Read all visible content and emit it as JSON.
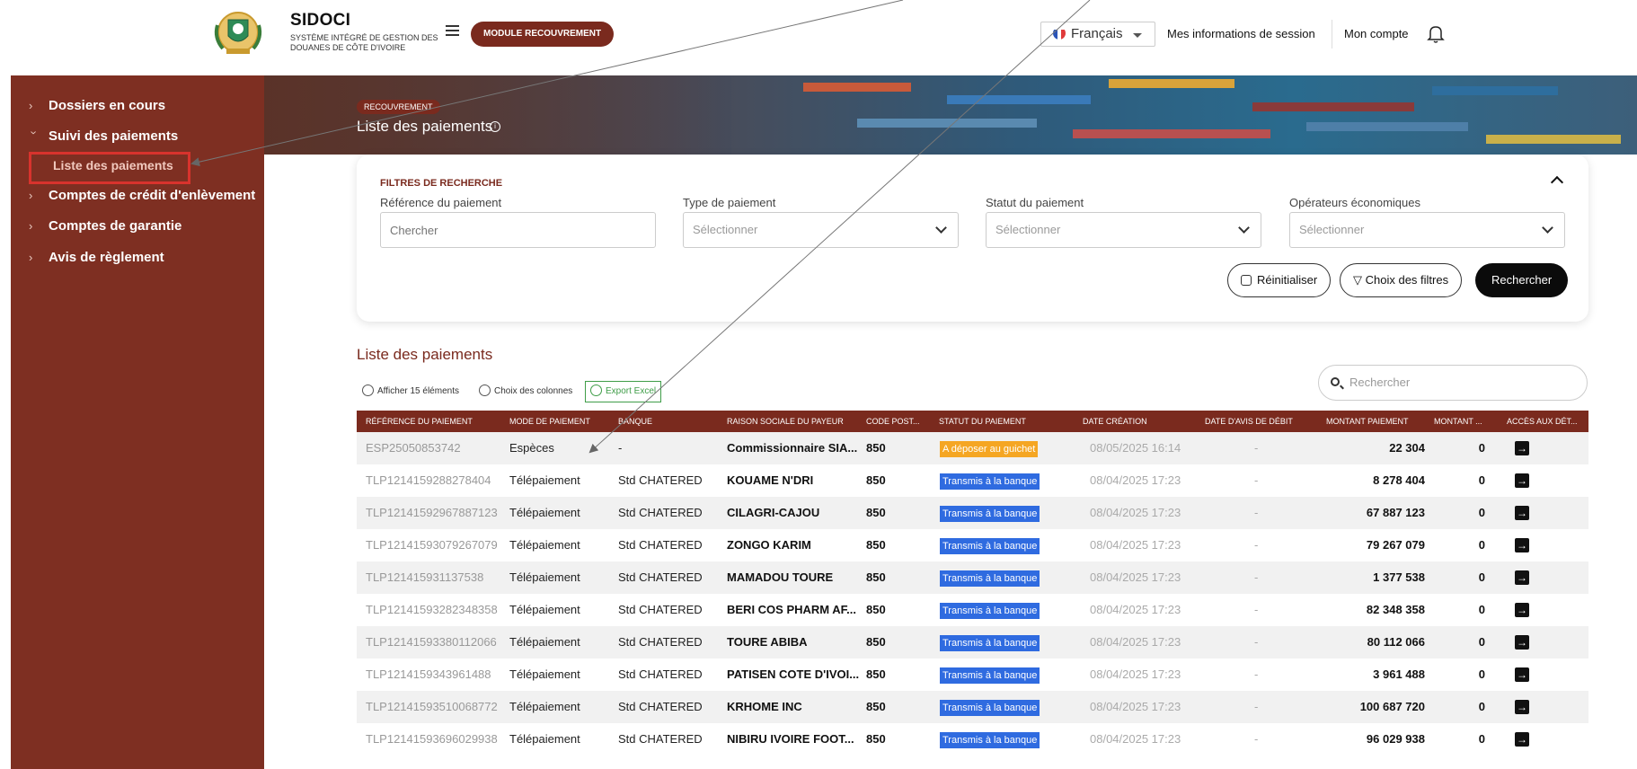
{
  "header": {
    "brand_name": "SIDOCI",
    "brand_sub": "Système intégré de gestion des douanes de Côte d'Ivoire",
    "module_button": "MODULE RECOUVREMENT",
    "language": "Français",
    "session_link": "Mes informations de session",
    "account_link": "Mon compte"
  },
  "sidebar": {
    "items": [
      {
        "label": "Dossiers en cours"
      },
      {
        "label": "Suivi des paiements"
      },
      {
        "label": "Liste des paiements"
      },
      {
        "label": "Comptes de crédit d'enlèvement"
      },
      {
        "label": "Comptes de garantie"
      },
      {
        "label": "Avis de règlement"
      }
    ]
  },
  "hero": {
    "breadcrumb": "RECOUVREMENT",
    "title": "Liste des paiements"
  },
  "filters": {
    "title": "FILTRES DE RECHERCHE",
    "ref_label": "Référence du paiement",
    "ref_placeholder": "Chercher",
    "type_label": "Type de paiement",
    "type_value": "Sélectionner",
    "status_label": "Statut du paiement",
    "status_value": "Sélectionner",
    "operators_label": "Opérateurs économiques",
    "operators_value": "Sélectionner",
    "reset_button": "Réinitialiser",
    "choose_filters_button": "Choix des filtres",
    "search_button": "Rechercher"
  },
  "list": {
    "title": "Liste des paiements",
    "show_items": "Afficher 15 éléments",
    "choose_columns": "Choix des colonnes",
    "export": "Export Excel",
    "search_placeholder": "Rechercher",
    "columns": [
      "RÉFÉRENCE DU PAIEMENT",
      "MODE DE PAIEMENT",
      "BANQUE",
      "RAISON SOCIALE DU PAYEUR",
      "CODE POST...",
      "STATUT DU PAIEMENT",
      "DATE CRÉATION",
      "DATE D'AVIS DE DÉBIT",
      "MONTANT PAIEMENT",
      "MONTANT ...",
      "ACCÈS AUX DÉT..."
    ],
    "rows": [
      {
        "ref": "ESP25050853742",
        "mode": "Espèces",
        "bank": "-",
        "payer": "Commissionnaire SIA...",
        "code": "850",
        "status": "A déposer au guichet",
        "status_color": "#f5a623",
        "created": "08/05/2025 16:14",
        "debit": "-",
        "amount": "22 304",
        "amount2": "0"
      },
      {
        "ref": "TLP1214159288278404",
        "mode": "Télépaiement",
        "bank": "Std CHATERED",
        "payer": "KOUAME N'DRI",
        "code": "850",
        "status": "Transmis à la banque",
        "status_color": "#2f6be0",
        "created": "08/04/2025 17:23",
        "debit": "-",
        "amount": "8 278 404",
        "amount2": "0"
      },
      {
        "ref": "TLP12141592967887123",
        "mode": "Télépaiement",
        "bank": "Std CHATERED",
        "payer": "CILAGRI-CAJOU",
        "code": "850",
        "status": "Transmis à la banque",
        "status_color": "#2f6be0",
        "created": "08/04/2025 17:23",
        "debit": "-",
        "amount": "67 887 123",
        "amount2": "0"
      },
      {
        "ref": "TLP12141593079267079",
        "mode": "Télépaiement",
        "bank": "Std CHATERED",
        "payer": "ZONGO KARIM",
        "code": "850",
        "status": "Transmis à la banque",
        "status_color": "#2f6be0",
        "created": "08/04/2025 17:23",
        "debit": "-",
        "amount": "79 267 079",
        "amount2": "0"
      },
      {
        "ref": "TLP121415931137538",
        "mode": "Télépaiement",
        "bank": "Std CHATERED",
        "payer": "MAMADOU TOURE",
        "code": "850",
        "status": "Transmis à la banque",
        "status_color": "#2f6be0",
        "created": "08/04/2025 17:23",
        "debit": "-",
        "amount": "1 377 538",
        "amount2": "0"
      },
      {
        "ref": "TLP12141593282348358",
        "mode": "Télépaiement",
        "bank": "Std CHATERED",
        "payer": "BERI COS PHARM AF...",
        "code": "850",
        "status": "Transmis à la banque",
        "status_color": "#2f6be0",
        "created": "08/04/2025 17:23",
        "debit": "-",
        "amount": "82 348 358",
        "amount2": "0"
      },
      {
        "ref": "TLP12141593380112066",
        "mode": "Télépaiement",
        "bank": "Std CHATERED",
        "payer": "TOURE ABIBA",
        "code": "850",
        "status": "Transmis à la banque",
        "status_color": "#2f6be0",
        "created": "08/04/2025 17:23",
        "debit": "-",
        "amount": "80 112 066",
        "amount2": "0"
      },
      {
        "ref": "TLP1214159343961488",
        "mode": "Télépaiement",
        "bank": "Std CHATERED",
        "payer": "PATISEN COTE D'IVOI...",
        "code": "850",
        "status": "Transmis à la banque",
        "status_color": "#2f6be0",
        "created": "08/04/2025 17:23",
        "debit": "-",
        "amount": "3 961 488",
        "amount2": "0"
      },
      {
        "ref": "TLP12141593510068772",
        "mode": "Télépaiement",
        "bank": "Std CHATERED",
        "payer": "KRHOME INC",
        "code": "850",
        "status": "Transmis à la banque",
        "status_color": "#2f6be0",
        "created": "08/04/2025 17:23",
        "debit": "-",
        "amount": "100 687 720",
        "amount2": "0"
      },
      {
        "ref": "TLP12141593696029938",
        "mode": "Télépaiement",
        "bank": "Std CHATERED",
        "payer": "NIBIRU IVOIRE FOOT...",
        "code": "850",
        "status": "Transmis à la banque",
        "status_color": "#2f6be0",
        "created": "08/04/2025 17:23",
        "debit": "-",
        "amount": "96 029 938",
        "amount2": "0"
      }
    ]
  },
  "colors": {
    "brand": "#7a2a1e",
    "sidebar": "#7e2f22",
    "highlight": "#d8332d"
  }
}
